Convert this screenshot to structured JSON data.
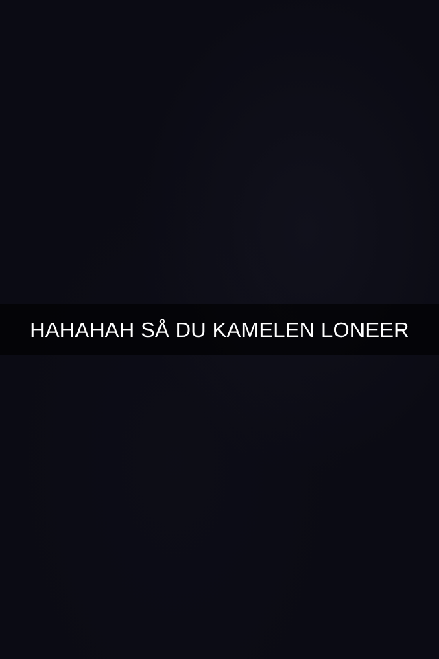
{
  "snap": {
    "background_color": "#0b0b14",
    "caption": {
      "text": "HAHAHAH SÅ DU KAMELEN LONEER",
      "text_color": "#ffffff",
      "bar_color": "rgba(0,0,0,0.62)"
    }
  }
}
